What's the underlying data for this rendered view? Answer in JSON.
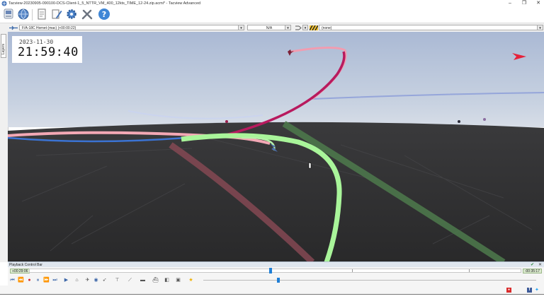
{
  "window": {
    "title": "Tacview-20230905-090100-DCS-Client-1_5_NTTR_VM_400_12kts_TIME_12-24.zip.acmi* - Tacview Advanced",
    "minimize": "–",
    "maximize": "❐",
    "close": "✕"
  },
  "objectbar": {
    "selected_object": "F/A-18C Hornet (mac) (+00:00:22)",
    "target": "N/A",
    "secondary": "(none)"
  },
  "side_tab": "Layers",
  "clock": {
    "date": "2023-11-30",
    "time": "21:59:40"
  },
  "playback": {
    "bar_label": "Playback Control Bar",
    "start_time": "+00:29:06",
    "end_time": "-00:35:17",
    "progress": 0.49
  },
  "colors": {
    "sky_top": "#aab9d4",
    "ground": "#2d2d2f",
    "trail_green": "#a9f59a",
    "trail_pink": "#f7a4b0",
    "trail_magenta": "#b81a5e",
    "accent_blue": "#1f7fd6"
  }
}
